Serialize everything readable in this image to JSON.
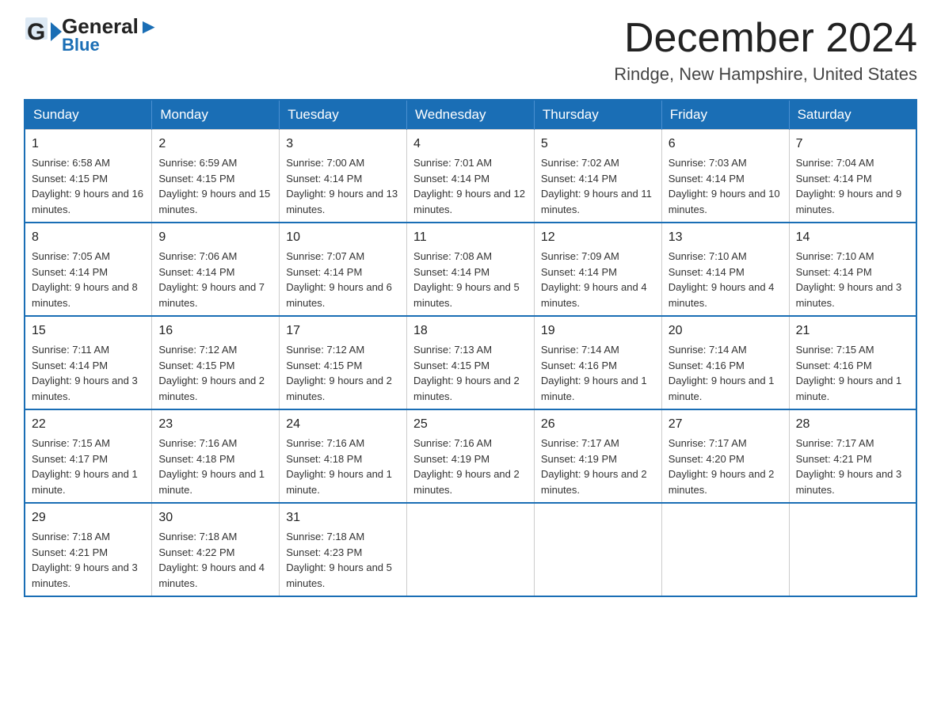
{
  "header": {
    "logo_general": "General",
    "logo_blue": "Blue",
    "title": "December 2024",
    "subtitle": "Rindge, New Hampshire, United States"
  },
  "days_of_week": [
    "Sunday",
    "Monday",
    "Tuesday",
    "Wednesday",
    "Thursday",
    "Friday",
    "Saturday"
  ],
  "weeks": [
    [
      {
        "day": "1",
        "sunrise": "6:58 AM",
        "sunset": "4:15 PM",
        "daylight": "9 hours and 16 minutes."
      },
      {
        "day": "2",
        "sunrise": "6:59 AM",
        "sunset": "4:15 PM",
        "daylight": "9 hours and 15 minutes."
      },
      {
        "day": "3",
        "sunrise": "7:00 AM",
        "sunset": "4:14 PM",
        "daylight": "9 hours and 13 minutes."
      },
      {
        "day": "4",
        "sunrise": "7:01 AM",
        "sunset": "4:14 PM",
        "daylight": "9 hours and 12 minutes."
      },
      {
        "day": "5",
        "sunrise": "7:02 AM",
        "sunset": "4:14 PM",
        "daylight": "9 hours and 11 minutes."
      },
      {
        "day": "6",
        "sunrise": "7:03 AM",
        "sunset": "4:14 PM",
        "daylight": "9 hours and 10 minutes."
      },
      {
        "day": "7",
        "sunrise": "7:04 AM",
        "sunset": "4:14 PM",
        "daylight": "9 hours and 9 minutes."
      }
    ],
    [
      {
        "day": "8",
        "sunrise": "7:05 AM",
        "sunset": "4:14 PM",
        "daylight": "9 hours and 8 minutes."
      },
      {
        "day": "9",
        "sunrise": "7:06 AM",
        "sunset": "4:14 PM",
        "daylight": "9 hours and 7 minutes."
      },
      {
        "day": "10",
        "sunrise": "7:07 AM",
        "sunset": "4:14 PM",
        "daylight": "9 hours and 6 minutes."
      },
      {
        "day": "11",
        "sunrise": "7:08 AM",
        "sunset": "4:14 PM",
        "daylight": "9 hours and 5 minutes."
      },
      {
        "day": "12",
        "sunrise": "7:09 AM",
        "sunset": "4:14 PM",
        "daylight": "9 hours and 4 minutes."
      },
      {
        "day": "13",
        "sunrise": "7:10 AM",
        "sunset": "4:14 PM",
        "daylight": "9 hours and 4 minutes."
      },
      {
        "day": "14",
        "sunrise": "7:10 AM",
        "sunset": "4:14 PM",
        "daylight": "9 hours and 3 minutes."
      }
    ],
    [
      {
        "day": "15",
        "sunrise": "7:11 AM",
        "sunset": "4:14 PM",
        "daylight": "9 hours and 3 minutes."
      },
      {
        "day": "16",
        "sunrise": "7:12 AM",
        "sunset": "4:15 PM",
        "daylight": "9 hours and 2 minutes."
      },
      {
        "day": "17",
        "sunrise": "7:12 AM",
        "sunset": "4:15 PM",
        "daylight": "9 hours and 2 minutes."
      },
      {
        "day": "18",
        "sunrise": "7:13 AM",
        "sunset": "4:15 PM",
        "daylight": "9 hours and 2 minutes."
      },
      {
        "day": "19",
        "sunrise": "7:14 AM",
        "sunset": "4:16 PM",
        "daylight": "9 hours and 1 minute."
      },
      {
        "day": "20",
        "sunrise": "7:14 AM",
        "sunset": "4:16 PM",
        "daylight": "9 hours and 1 minute."
      },
      {
        "day": "21",
        "sunrise": "7:15 AM",
        "sunset": "4:16 PM",
        "daylight": "9 hours and 1 minute."
      }
    ],
    [
      {
        "day": "22",
        "sunrise": "7:15 AM",
        "sunset": "4:17 PM",
        "daylight": "9 hours and 1 minute."
      },
      {
        "day": "23",
        "sunrise": "7:16 AM",
        "sunset": "4:18 PM",
        "daylight": "9 hours and 1 minute."
      },
      {
        "day": "24",
        "sunrise": "7:16 AM",
        "sunset": "4:18 PM",
        "daylight": "9 hours and 1 minute."
      },
      {
        "day": "25",
        "sunrise": "7:16 AM",
        "sunset": "4:19 PM",
        "daylight": "9 hours and 2 minutes."
      },
      {
        "day": "26",
        "sunrise": "7:17 AM",
        "sunset": "4:19 PM",
        "daylight": "9 hours and 2 minutes."
      },
      {
        "day": "27",
        "sunrise": "7:17 AM",
        "sunset": "4:20 PM",
        "daylight": "9 hours and 2 minutes."
      },
      {
        "day": "28",
        "sunrise": "7:17 AM",
        "sunset": "4:21 PM",
        "daylight": "9 hours and 3 minutes."
      }
    ],
    [
      {
        "day": "29",
        "sunrise": "7:18 AM",
        "sunset": "4:21 PM",
        "daylight": "9 hours and 3 minutes."
      },
      {
        "day": "30",
        "sunrise": "7:18 AM",
        "sunset": "4:22 PM",
        "daylight": "9 hours and 4 minutes."
      },
      {
        "day": "31",
        "sunrise": "7:18 AM",
        "sunset": "4:23 PM",
        "daylight": "9 hours and 5 minutes."
      },
      null,
      null,
      null,
      null
    ]
  ],
  "labels": {
    "sunrise": "Sunrise:",
    "sunset": "Sunset:",
    "daylight": "Daylight:"
  }
}
